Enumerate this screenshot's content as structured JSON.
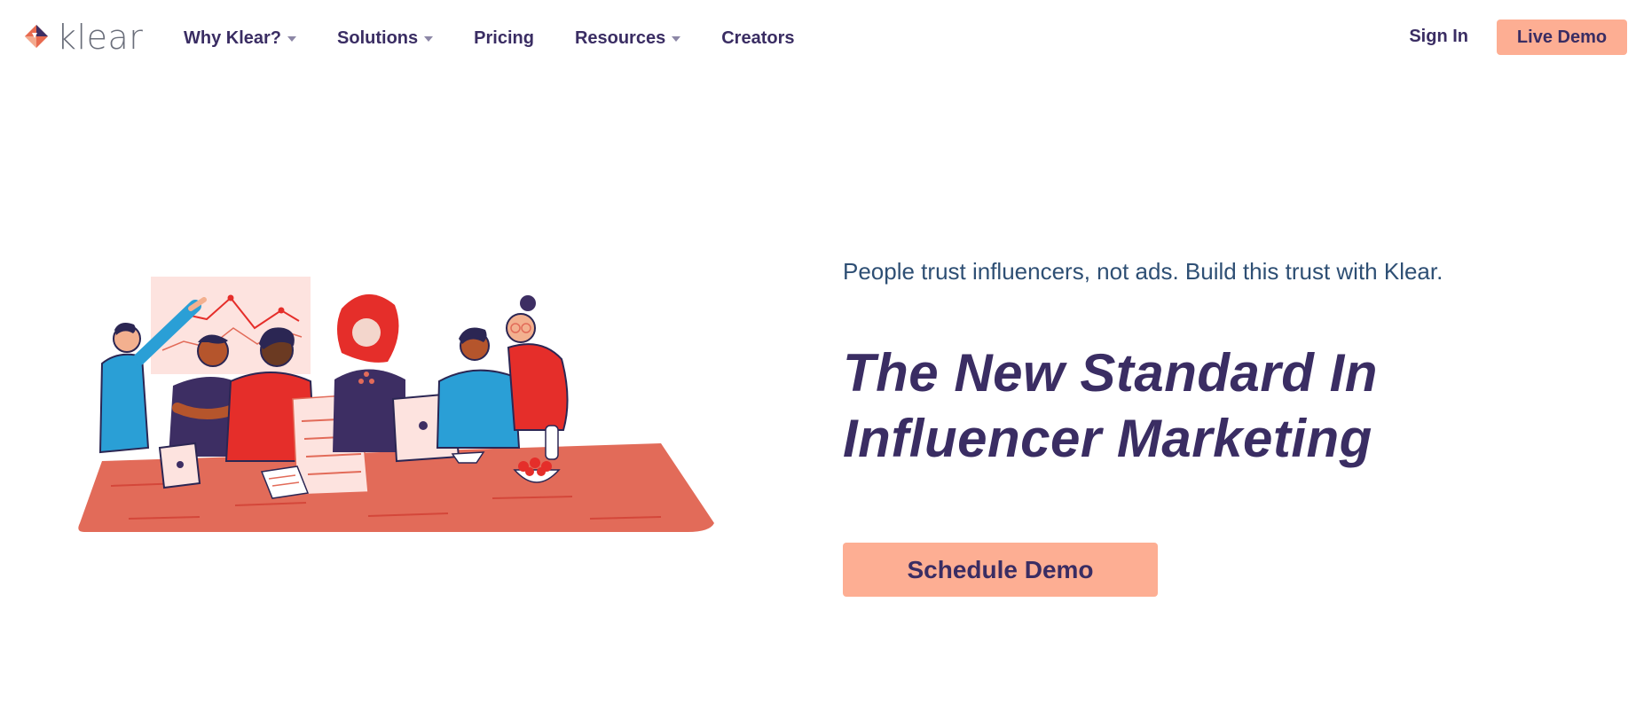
{
  "brand": {
    "name": "klear",
    "logo_icon": "klear-diamond-logo"
  },
  "nav": {
    "items": [
      {
        "label": "Why Klear?",
        "has_dropdown": true
      },
      {
        "label": "Solutions",
        "has_dropdown": true
      },
      {
        "label": "Pricing",
        "has_dropdown": false
      },
      {
        "label": "Resources",
        "has_dropdown": true
      },
      {
        "label": "Creators",
        "has_dropdown": false
      }
    ],
    "sign_in": "Sign In",
    "live_demo": "Live Demo"
  },
  "hero": {
    "tagline": "People trust influencers, not ads. Build this trust with Klear.",
    "headline_line1": "The New Standard In",
    "headline_line2": "Influencer Marketing",
    "cta": "Schedule Demo",
    "illustration": "team-meeting-illustration"
  },
  "colors": {
    "primary_text": "#3a2d63",
    "tagline_text": "#2e4f74",
    "button_bg": "#fdae93",
    "table_red": "#e26b59",
    "accent_blue": "#2a9fd6",
    "accent_red": "#e52e2a",
    "chart_pink": "#fde3df"
  }
}
